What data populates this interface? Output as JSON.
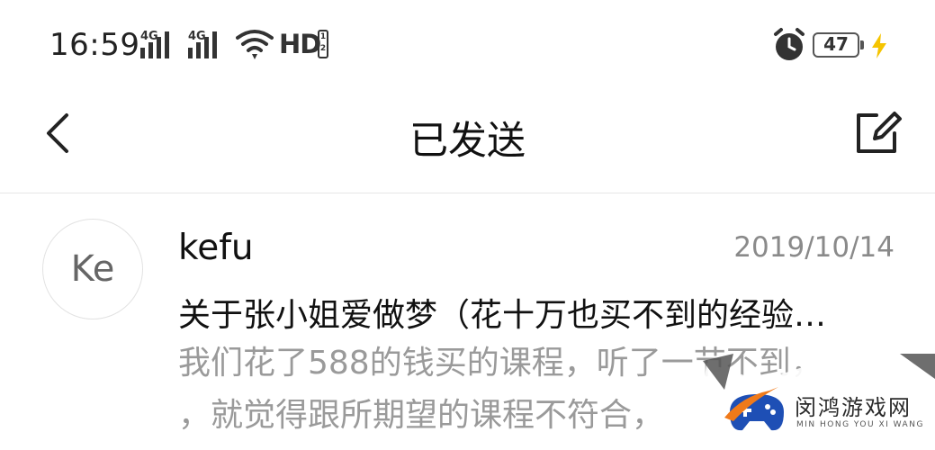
{
  "status_bar": {
    "time": "16:59",
    "network_1": "4G",
    "network_2": "4G",
    "hd": "HD",
    "hd_sim": "1 2",
    "battery_level": "47",
    "icons": [
      "signal-icon",
      "wifi-icon",
      "alarm-icon",
      "battery-icon",
      "charging-icon"
    ]
  },
  "header": {
    "title": "已发送",
    "back_icon": "chevron-left-icon",
    "compose_icon": "edit-icon"
  },
  "mail": {
    "avatar_initials": "Ke",
    "sender": "kefu",
    "date": "2019/10/14",
    "subject": "关于张小姐爱做梦（花十万也买不到的经验…",
    "preview_line_1": "我们花了588的钱买的课程，听了一节不到，",
    "preview_line_2": "，就觉得跟所期望的课程不符合，"
  },
  "watermark": {
    "title": "闵鸿游戏网",
    "subtitle": "MIN HONG YOU XI WANG"
  },
  "colors": {
    "background": "#ffffff",
    "text_primary": "#111111",
    "text_secondary": "#9a9a9a",
    "date": "#8a8a8a",
    "divider": "#e6e6e6",
    "charging": "#f5c400",
    "watermark_logo_blue": "#1e4fb5",
    "watermark_logo_orange": "#f07a1a"
  }
}
